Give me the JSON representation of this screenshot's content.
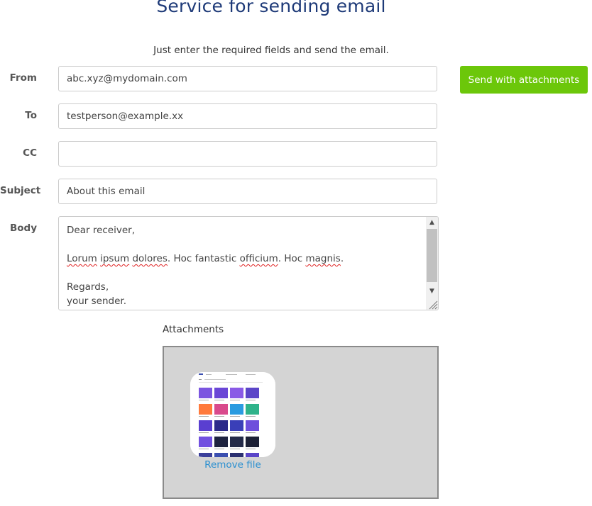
{
  "page": {
    "title": "Service for sending email",
    "subtitle": "Just enter the required fields and send the email."
  },
  "form": {
    "from": {
      "label": "From",
      "value": "abc.xyz@mydomain.com"
    },
    "to": {
      "label": "To",
      "value": "testperson@example.xx"
    },
    "cc": {
      "label": "CC",
      "value": ""
    },
    "subject": {
      "label": "Subject",
      "value": "About this email"
    },
    "body": {
      "label": "Body",
      "greeting": "Dear receiver,",
      "line_words": [
        "Lorum",
        "ipsum",
        "dolores",
        ". Hoc fantastic ",
        "officium",
        ". Hoc ",
        "magnis",
        "."
      ],
      "regards": "Regards,",
      "sender": "your sender."
    }
  },
  "actions": {
    "send_label": "Send with attachments"
  },
  "attachments": {
    "label": "Attachments",
    "remove_label": "Remove file"
  },
  "colors": {
    "title": "#1e3a78",
    "send_button": "#6cc70a",
    "link": "#2a8fd0",
    "dropzone": "#d4d4d4"
  }
}
